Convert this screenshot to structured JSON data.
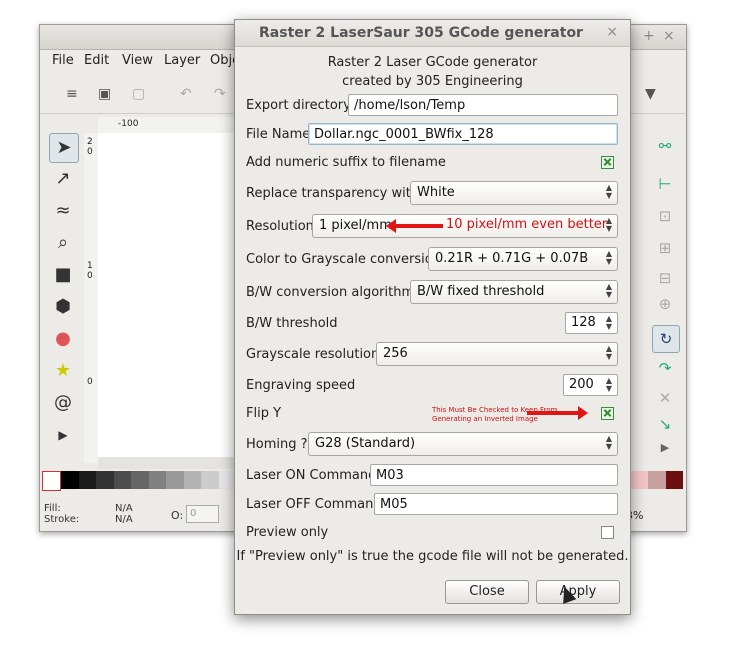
{
  "background": {
    "menus": [
      "File",
      "Edit",
      "View",
      "Layer",
      "Obje"
    ],
    "ruler_h_label": "-100",
    "ruler_v_labels": [
      "2",
      "0",
      "1",
      "0",
      "0"
    ],
    "status": {
      "fill_label": "Fill:",
      "fill_value": "N/A",
      "stroke_label": "Stroke:",
      "stroke_value": "N/A",
      "o_label": "O:",
      "o_value": "0"
    },
    "zoom_text": "3%"
  },
  "dialog": {
    "title": "Raster 2 LaserSaur 305 GCode generator",
    "header_line1": "Raster 2 Laser GCode generator",
    "header_line2": "created by 305 Engineering",
    "fields": {
      "export_directory": {
        "label": "Export directory",
        "value": "/home/lson/Temp"
      },
      "file_name": {
        "label": "File Name",
        "value": "Dollar.ngc_0001_BWfix_128"
      },
      "numeric_suffix": {
        "label": "Add numeric suffix to filename",
        "checked": true
      },
      "transparency": {
        "label": "Replace transparency with",
        "value": "White"
      },
      "resolution": {
        "label": "Resolution",
        "value": "1 pixel/mm"
      },
      "grayscale_conversion": {
        "label": "Color to Grayscale conversion",
        "value": "0.21R + 0.71G + 0.07B"
      },
      "bw_algorithm": {
        "label": "B/W conversion algorithm",
        "value": "B/W fixed threshold"
      },
      "bw_threshold": {
        "label": "B/W threshold",
        "value": "128"
      },
      "grayscale_resolution": {
        "label": "Grayscale resolution",
        "value": "256"
      },
      "engraving_speed": {
        "label": "Engraving speed",
        "value": "200"
      },
      "flip_y": {
        "label": "Flip Y",
        "checked": true
      },
      "homing": {
        "label": "Homing ?",
        "value": "G28 (Standard)"
      },
      "laser_on": {
        "label": "Laser ON Command",
        "value": "M03"
      },
      "laser_off": {
        "label": "Laser OFF Command",
        "value": "M05"
      },
      "preview_only": {
        "label": "Preview only",
        "checked": false
      }
    },
    "info_text": "If \"Preview only\" is true the gcode file will not be generated.",
    "buttons": {
      "close": "Close",
      "apply": "Apply"
    }
  },
  "annotations": {
    "resolution_note": "10 pixel/mm even better",
    "flip_note": "This Must Be Checked to Keep From Generating an Inverted Image"
  },
  "colors": {
    "annotation_red": "#e01616",
    "checkbox_green": "#2f8a2f"
  }
}
